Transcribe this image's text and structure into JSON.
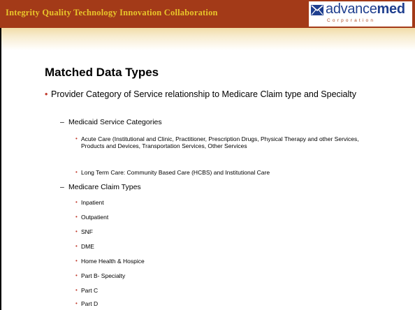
{
  "header": {
    "tagline": "Integrity  Quality  Technology  Innovation  Collaboration",
    "logo_part1": "advance",
    "logo_part2": "med",
    "logo_sub": "Corporation"
  },
  "slide": {
    "title": "Matched Data Types",
    "bullet1": "Provider Category of Service relationship to Medicare Claim type and Specialty",
    "medicaid_heading": "Medicaid Service Categories",
    "medicaid_items": [
      "Acute Care (Institutional and Clinic, Practitioner, Prescription Drugs, Physical Therapy and other Services, Products and Devices, Transportation Services, Other Services",
      "Long Term Care: Community Based Care (HCBS) and Institutional Care"
    ],
    "medicare_heading": "Medicare Claim Types",
    "medicare_items": [
      "Inpatient",
      "Outpatient",
      "SNF",
      "DME",
      "Home Health & Hospice",
      "Part B- Specialty",
      "Part C",
      "Part D"
    ],
    "bullet_char": "•",
    "dash_char": "–"
  },
  "colors": {
    "banner": "#a33a18",
    "tagline": "#e8c52a",
    "logo_blue": "#1f3f8f",
    "bullet": "#c0392b"
  }
}
